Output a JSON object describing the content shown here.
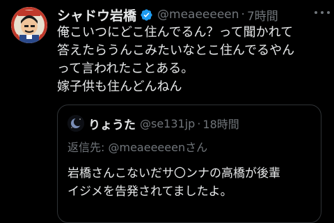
{
  "tweet": {
    "author": {
      "display_name": "シャドウ岩橋",
      "handle": "@meaeeeeen",
      "verified": true,
      "avatar_icon": "cartoon-portrait-avatar"
    },
    "separator": "·",
    "time": "7時間",
    "lines": [
      "俺こいつにどこ住んでるん？って聞かれて",
      "答えたらうんこみたいなとこ住んでるやん",
      "って言われたことある。",
      "嫁子供も住んどんねん"
    ],
    "more_icon": "more-horizontal-icon"
  },
  "quoted_tweet": {
    "author": {
      "display_name": "りょうた",
      "handle": "@se131jp",
      "avatar_icon": "blue-moon-avatar"
    },
    "separator": "·",
    "time": "18時間",
    "reply_to_prefix": "返信先: ",
    "reply_to_handle": "@meaeeeeen",
    "reply_to_suffix": "さん",
    "lines": [
      "岩橋さんこないだサ〇ンナの高橋が後輩",
      "イジメを告発されてましたよ。"
    ]
  },
  "colors": {
    "background": "#000000",
    "text_primary": "#e7e9ea",
    "text_secondary": "#71767b",
    "verified_badge": "#1d9bf0",
    "border": "#2f3336"
  }
}
